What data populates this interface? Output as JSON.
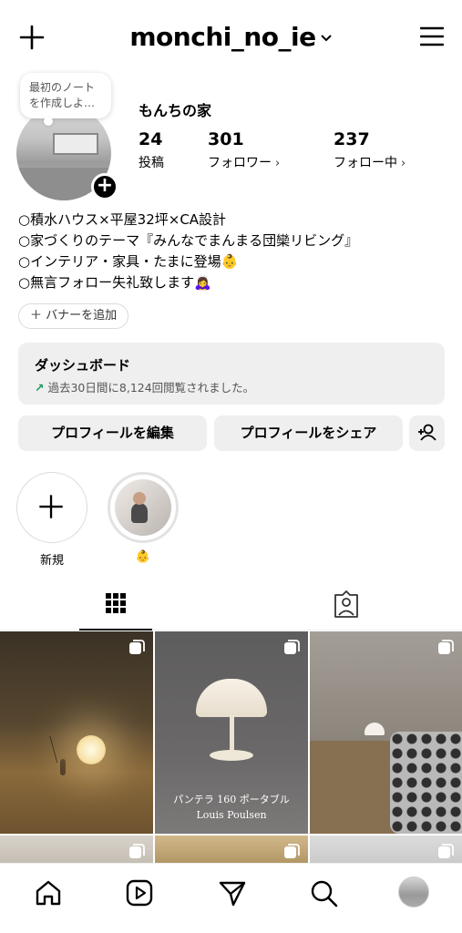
{
  "header": {
    "username": "monchi_no_ie"
  },
  "profile": {
    "note": "最初のノートを作成しよ…",
    "display_name": "もんちの家",
    "stats": {
      "posts": {
        "value": "24",
        "label": "投稿"
      },
      "followers": {
        "value": "301",
        "label": "フォロワー",
        "arrow": "›"
      },
      "following": {
        "value": "237",
        "label": "フォロー中",
        "arrow": "›"
      }
    },
    "bio": [
      "○積水ハウス×平屋32坪×CA設計",
      "○家づくりのテーマ『みんなでまんまる団欒リビング』",
      "○インテリア・家具・たまに登場👶",
      "○無言フォロー失礼致します🙇‍♀️"
    ],
    "add_banner": "＋ バナーを追加"
  },
  "dashboard": {
    "title": "ダッシュボード",
    "subtitle": "過去30日間に8,124回閲覧されました。",
    "arrow": "↗"
  },
  "actions": {
    "edit_profile": "プロフィールを編集",
    "share_profile": "プロフィールをシェア"
  },
  "highlights": [
    {
      "label": "新規"
    },
    {
      "label": "👶"
    }
  ],
  "posts": [
    {
      "caption_line1": "",
      "caption_line2": ""
    },
    {
      "caption_line1": "パンテラ 160 ポータブル",
      "caption_line2": "Louis Poulsen"
    },
    {
      "caption_line1": "",
      "caption_line2": ""
    }
  ]
}
